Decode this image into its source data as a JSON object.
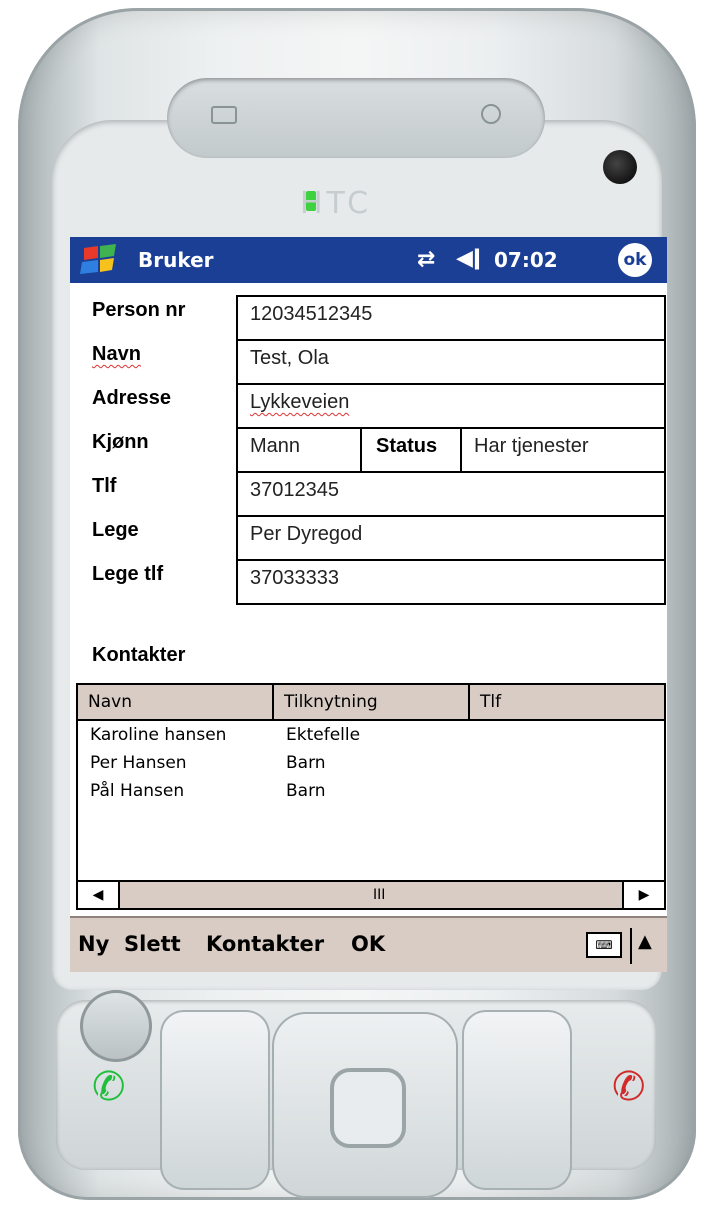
{
  "device": {
    "brand": "HTC"
  },
  "titlebar": {
    "app_title": "Bruker",
    "time": "07:02",
    "ok_label": "ok",
    "icons": [
      "start-flag-icon",
      "connectivity-icon",
      "volume-icon"
    ]
  },
  "form": {
    "person_nr_label": "Person nr",
    "person_nr_value": "12034512345",
    "navn_label": "Navn",
    "navn_value": "Test, Ola",
    "adresse_label": "Adresse",
    "adresse_value": "Lykkeveien",
    "kjonn_label": "Kjønn",
    "kjonn_value": "Mann",
    "status_label": "Status",
    "status_value": "Har tjenester",
    "tlf_label": "Tlf",
    "tlf_value": "37012345",
    "lege_label": "Lege",
    "lege_value": "Per Dyregod",
    "lege_tlf_label": "Lege tlf",
    "lege_tlf_value": "37033333"
  },
  "contacts": {
    "heading": "Kontakter",
    "columns": [
      "Navn",
      "Tilknytning",
      "Tlf"
    ],
    "rows": [
      {
        "navn": "Karoline hansen",
        "tilknytning": "Ektefelle",
        "tlf": ""
      },
      {
        "navn": "Per Hansen",
        "tilknytning": "Barn",
        "tlf": ""
      },
      {
        "navn": "Pål Hansen",
        "tilknytning": "Barn",
        "tlf": ""
      }
    ],
    "scroll_thumb": "III"
  },
  "menubar": {
    "items": [
      "Ny",
      "Slett",
      "Kontakter",
      "OK"
    ],
    "icons": [
      "keyboard-icon",
      "arrow-up-icon"
    ]
  },
  "colors": {
    "titlebar": "#1b3f94",
    "menubar": "#d8ccc4",
    "call_green": "#1fbf3c",
    "call_red": "#d12a2a"
  }
}
